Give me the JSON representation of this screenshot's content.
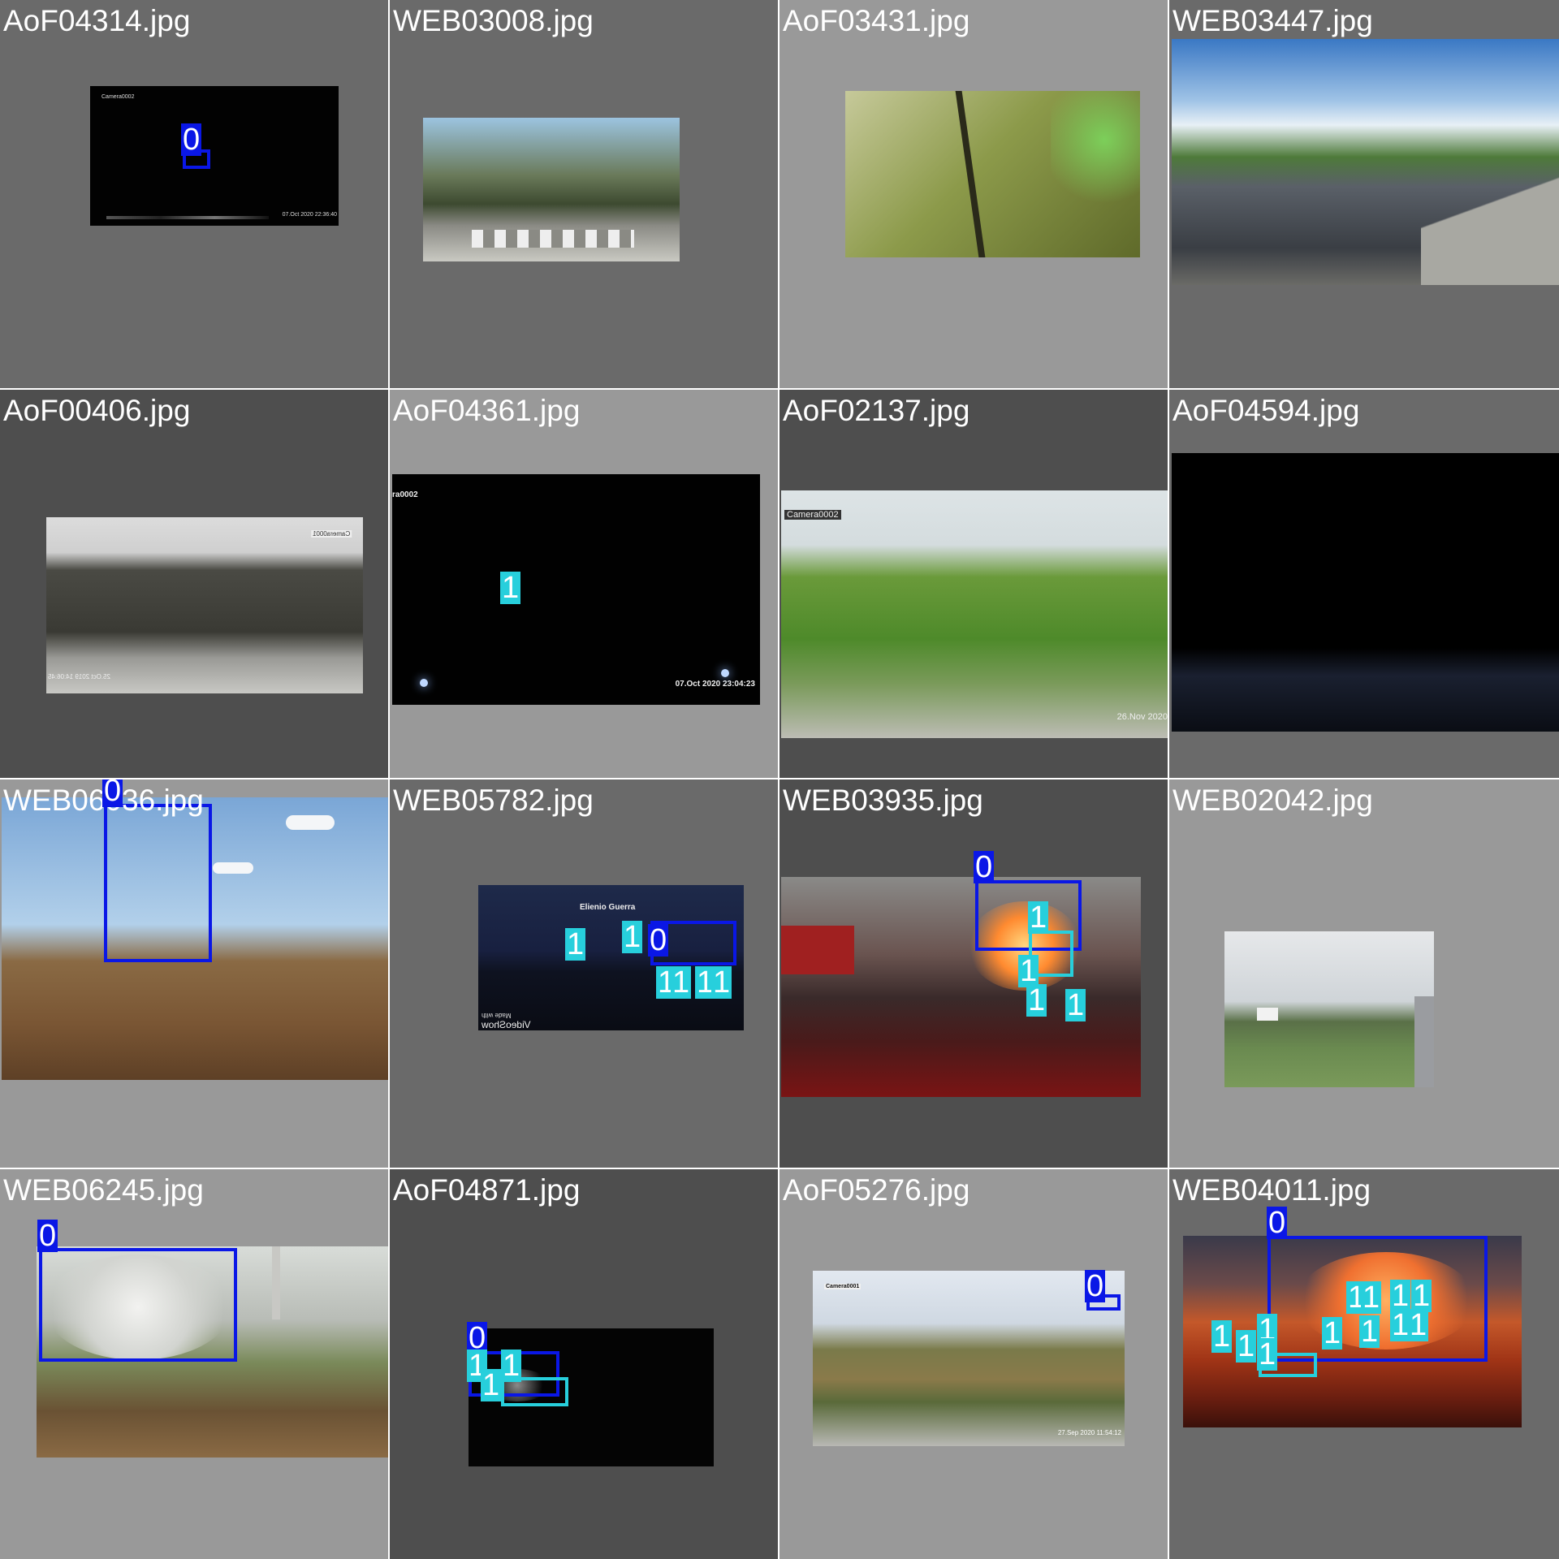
{
  "colors": {
    "class0": "#0a17e6",
    "class1": "#27cfdc",
    "bg_dark": "#4e4e4e",
    "bg_mid": "#6a6a6a",
    "bg_light": "#999999"
  },
  "tiles": [
    {
      "filename": "AoF04314.jpg",
      "overlays": [
        "Camera0002",
        "07.Oct 2020  22:36:40"
      ],
      "labels": [
        "0"
      ]
    },
    {
      "filename": "WEB03008.jpg",
      "overlays": [],
      "labels": []
    },
    {
      "filename": "AoF03431.jpg",
      "overlays": [],
      "labels": []
    },
    {
      "filename": "WEB03447.jpg",
      "overlays": [],
      "labels": []
    },
    {
      "filename": "AoF00406.jpg",
      "overlays": [
        "Camera0001",
        "25.Oct 2019  14:06:45"
      ],
      "labels": []
    },
    {
      "filename": "AoF04361.jpg",
      "overlays": [
        "ra0002",
        "07.Oct 2020   23:04:23"
      ],
      "labels": [
        "1"
      ]
    },
    {
      "filename": "AoF02137.jpg",
      "overlays": [
        "Camera0002",
        "26.Nov 2020"
      ],
      "labels": []
    },
    {
      "filename": "AoF04594.jpg",
      "overlays": [],
      "labels": []
    },
    {
      "filename": "WEB06036.jpg",
      "overlays": [],
      "labels": [
        "0"
      ]
    },
    {
      "filename": "WEB05782.jpg",
      "overlays": [
        "Elienio Guerra",
        "Made with",
        "VideoShow"
      ],
      "labels": [
        "1",
        "1",
        "0",
        "1",
        "1",
        "1",
        "1"
      ]
    },
    {
      "filename": "WEB03935.jpg",
      "overlays": [],
      "labels": [
        "0",
        "1",
        "1",
        "1",
        "1"
      ]
    },
    {
      "filename": "WEB02042.jpg",
      "overlays": [],
      "labels": []
    },
    {
      "filename": "WEB06245.jpg",
      "overlays": [],
      "labels": [
        "0"
      ]
    },
    {
      "filename": "AoF04871.jpg",
      "overlays": [],
      "labels": [
        "0",
        "1",
        "1",
        "1"
      ]
    },
    {
      "filename": "AoF05276.jpg",
      "overlays": [
        "Camera0001",
        "27.Sep 2020   11:54:12"
      ],
      "labels": [
        "0"
      ]
    },
    {
      "filename": "WEB04011.jpg",
      "overlays": [],
      "labels": [
        "0",
        "1",
        "1",
        "1",
        "1",
        "1",
        "1",
        "1",
        "1",
        "1",
        "1",
        "1",
        "1"
      ]
    }
  ]
}
